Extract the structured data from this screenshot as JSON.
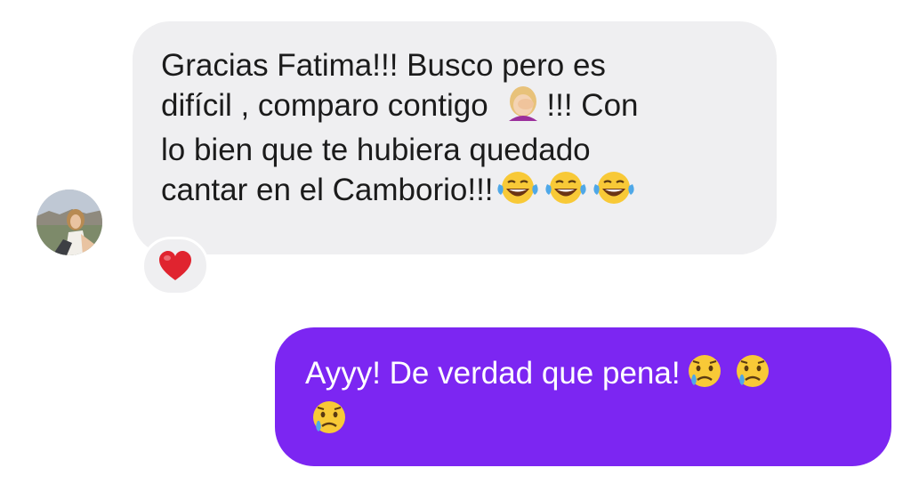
{
  "avatar": {
    "icon": "profile-photo"
  },
  "incoming_message": {
    "line_1": "Gracias Fatima!!! Busco pero es",
    "line_2_before_emoji": "difícil , comparo contigo ",
    "line_2_emoji": "woman-facepalming-emoji",
    "line_2_after_emoji": "!!! Con",
    "line_3": "lo bien que te hubiera quedado",
    "line_4": "cantar en el Camborio!!!",
    "line_4_emojis": [
      "tears-of-joy-emoji",
      "tears-of-joy-emoji",
      "tears-of-joy-emoji"
    ],
    "reaction": {
      "icon": "red-heart-emoji"
    }
  },
  "outgoing_message": {
    "line_1": "Ayyy! De verdad que pena!",
    "line_1_emojis": [
      "crying-face-emoji",
      "crying-face-emoji"
    ],
    "line_2_emojis": [
      "crying-face-emoji"
    ]
  },
  "colors": {
    "incoming_bubble": "#efeff1",
    "outgoing_bubble": "#7c26f2",
    "incoming_text": "#1b1b1b",
    "outgoing_text": "#ffffff",
    "heart": "#e0242f"
  }
}
